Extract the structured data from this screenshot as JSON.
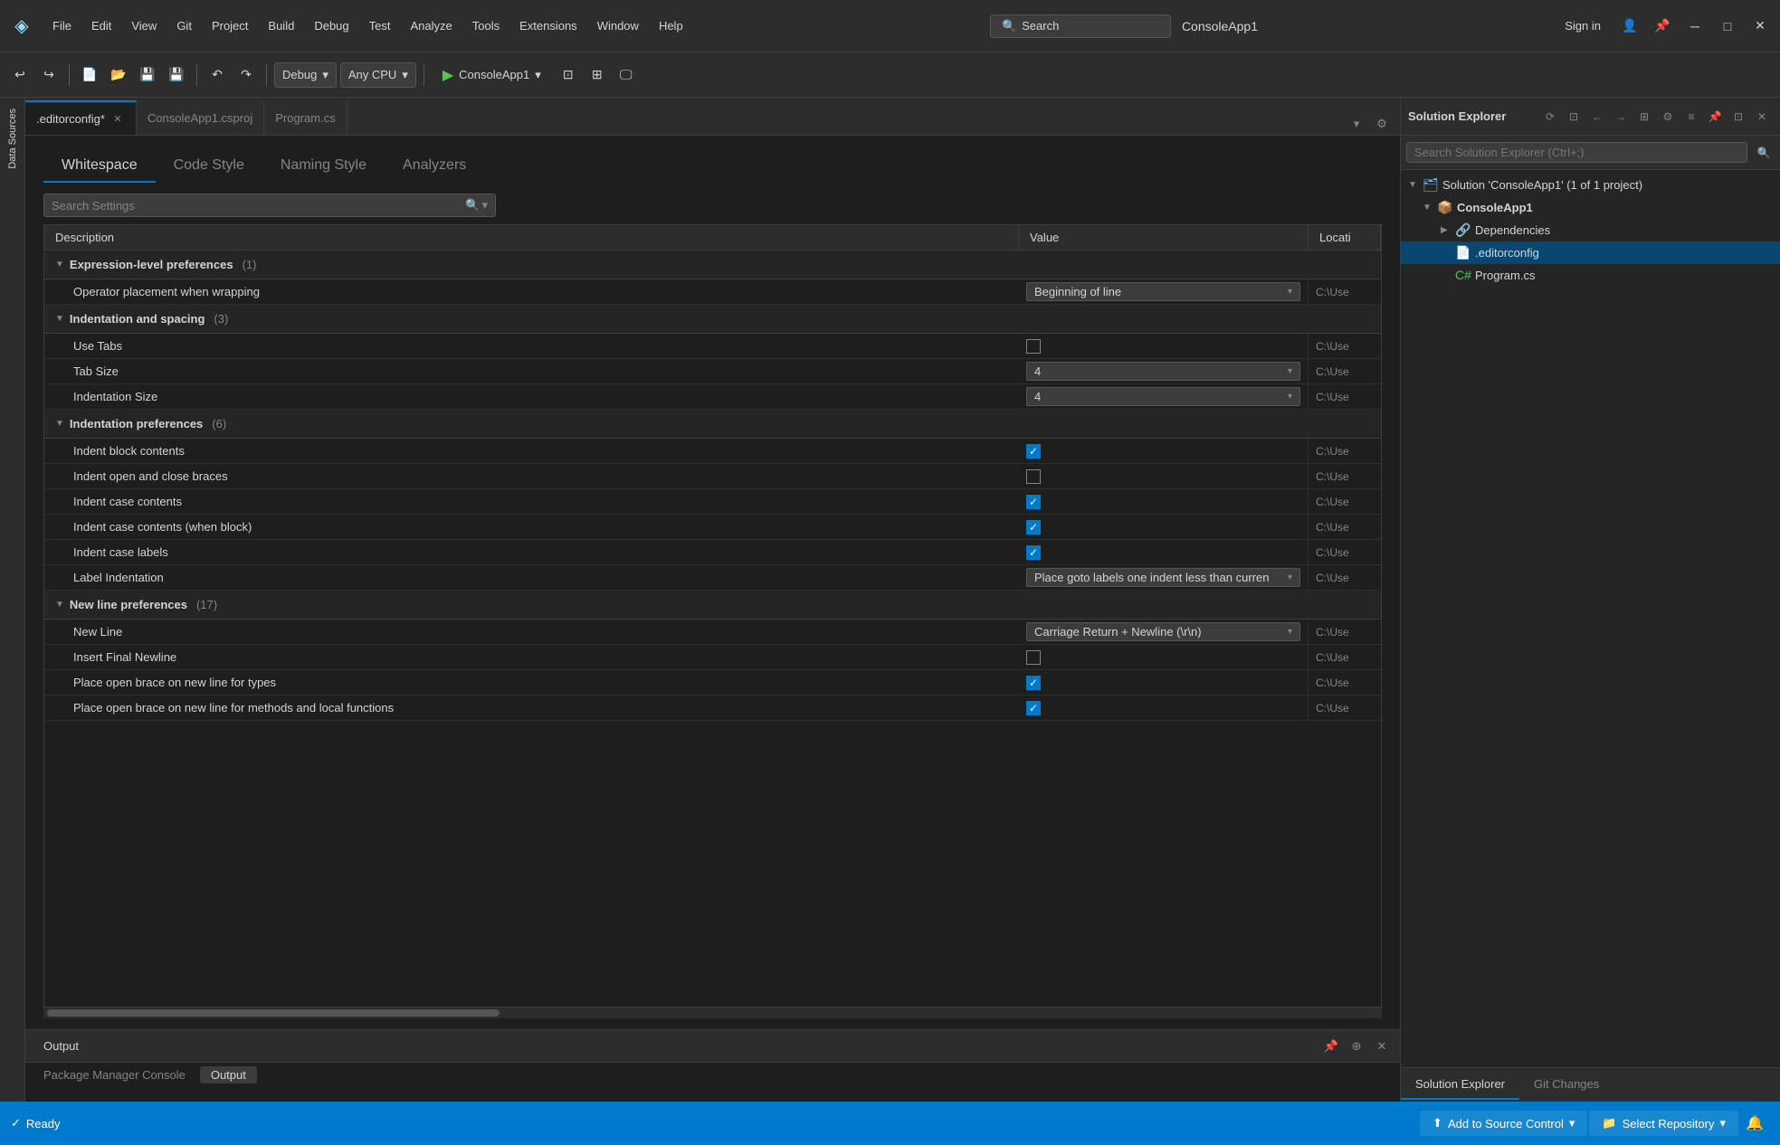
{
  "titlebar": {
    "logo": "◈",
    "menu": [
      "File",
      "Edit",
      "View",
      "Git",
      "Project",
      "Build",
      "Debug",
      "Test",
      "Analyze",
      "Tools",
      "Extensions",
      "Window",
      "Help"
    ],
    "search_label": "Search",
    "app_title": "ConsoleApp1",
    "signin": "Sign in",
    "actions": [
      "pin-icon",
      "minimize-icon",
      "maximize-icon",
      "close-icon"
    ]
  },
  "toolbar": {
    "nav_back": "←",
    "nav_forward": "→",
    "undo": "↶",
    "redo": "↷",
    "debug_config": "Debug",
    "platform": "Any CPU",
    "run_label": "ConsoleApp1",
    "run_icon": "▶",
    "separator": "|"
  },
  "tabs": [
    {
      "label": ".editorconfig*",
      "active": true,
      "modified": true,
      "closeable": true
    },
    {
      "label": "ConsoleApp1.csproj",
      "active": false,
      "closeable": false
    },
    {
      "label": "Program.cs",
      "active": false,
      "closeable": false
    }
  ],
  "settings": {
    "tabs": [
      "Whitespace",
      "Code Style",
      "Naming Style",
      "Analyzers"
    ],
    "active_tab": "Whitespace",
    "search_placeholder": "Search Settings",
    "search_icon": "🔍",
    "columns": [
      "Description",
      "Value",
      "Locati"
    ],
    "sections": [
      {
        "title": "Expression-level preferences",
        "count": "(1)",
        "collapsed": false,
        "rows": [
          {
            "desc": "Operator placement when wrapping",
            "value_type": "dropdown",
            "value": "Beginning of line",
            "location": "C:\\Use"
          }
        ]
      },
      {
        "title": "Indentation and spacing",
        "count": "(3)",
        "collapsed": false,
        "rows": [
          {
            "desc": "Use Tabs",
            "value_type": "checkbox",
            "checked": false,
            "location": "C:\\Use"
          },
          {
            "desc": "Tab Size",
            "value_type": "dropdown",
            "value": "4",
            "location": "C:\\Use"
          },
          {
            "desc": "Indentation Size",
            "value_type": "dropdown",
            "value": "4",
            "location": "C:\\Use"
          }
        ]
      },
      {
        "title": "Indentation preferences",
        "count": "(6)",
        "collapsed": false,
        "rows": [
          {
            "desc": "Indent block contents",
            "value_type": "checkbox",
            "checked": true,
            "location": "C:\\Use"
          },
          {
            "desc": "Indent open and close braces",
            "value_type": "checkbox",
            "checked": false,
            "location": "C:\\Use"
          },
          {
            "desc": "Indent case contents",
            "value_type": "checkbox",
            "checked": true,
            "location": "C:\\Use"
          },
          {
            "desc": "Indent case contents (when block)",
            "value_type": "checkbox",
            "checked": true,
            "location": "C:\\Use"
          },
          {
            "desc": "Indent case labels",
            "value_type": "checkbox",
            "checked": true,
            "location": "C:\\Use"
          },
          {
            "desc": "Label Indentation",
            "value_type": "dropdown",
            "value": "Place goto labels one indent less than curren",
            "location": "C:\\Use"
          }
        ]
      },
      {
        "title": "New line preferences",
        "count": "(17)",
        "collapsed": false,
        "rows": [
          {
            "desc": "New Line",
            "value_type": "dropdown",
            "value": "Carriage Return + Newline (\\r\\n)",
            "location": "C:\\Use"
          },
          {
            "desc": "Insert Final Newline",
            "value_type": "checkbox",
            "checked": false,
            "location": "C:\\Use"
          },
          {
            "desc": "Place open brace on new line for types",
            "value_type": "checkbox",
            "checked": true,
            "location": "C:\\Use"
          },
          {
            "desc": "Place open brace on new line for methods and local functions",
            "value_type": "checkbox",
            "checked": true,
            "location": "C:\\Use"
          }
        ]
      }
    ]
  },
  "output": {
    "title": "Output",
    "tabs": [
      "Package Manager Console",
      "Output"
    ],
    "active_tab": "Output"
  },
  "solution_explorer": {
    "title": "Solution Explorer",
    "search_placeholder": "Search Solution Explorer (Ctrl+;)",
    "tree": [
      {
        "level": 0,
        "label": "Solution 'ConsoleApp1' (1 of 1 project)",
        "icon": "solution",
        "expanded": true
      },
      {
        "level": 1,
        "label": "ConsoleApp1",
        "icon": "project",
        "expanded": true,
        "bold": true
      },
      {
        "level": 2,
        "label": "Dependencies",
        "icon": "deps",
        "expanded": false
      },
      {
        "level": 2,
        "label": ".editorconfig",
        "icon": "editorconfig",
        "active": true
      },
      {
        "level": 2,
        "label": "Program.cs",
        "icon": "cs"
      }
    ],
    "bottom_tabs": [
      "Solution Explorer",
      "Git Changes"
    ]
  },
  "status_bar": {
    "ready_icon": "✓",
    "ready": "Ready",
    "source_control": "Add to Source Control",
    "select_repo": "Select Repository",
    "notification_icon": "🔔"
  }
}
